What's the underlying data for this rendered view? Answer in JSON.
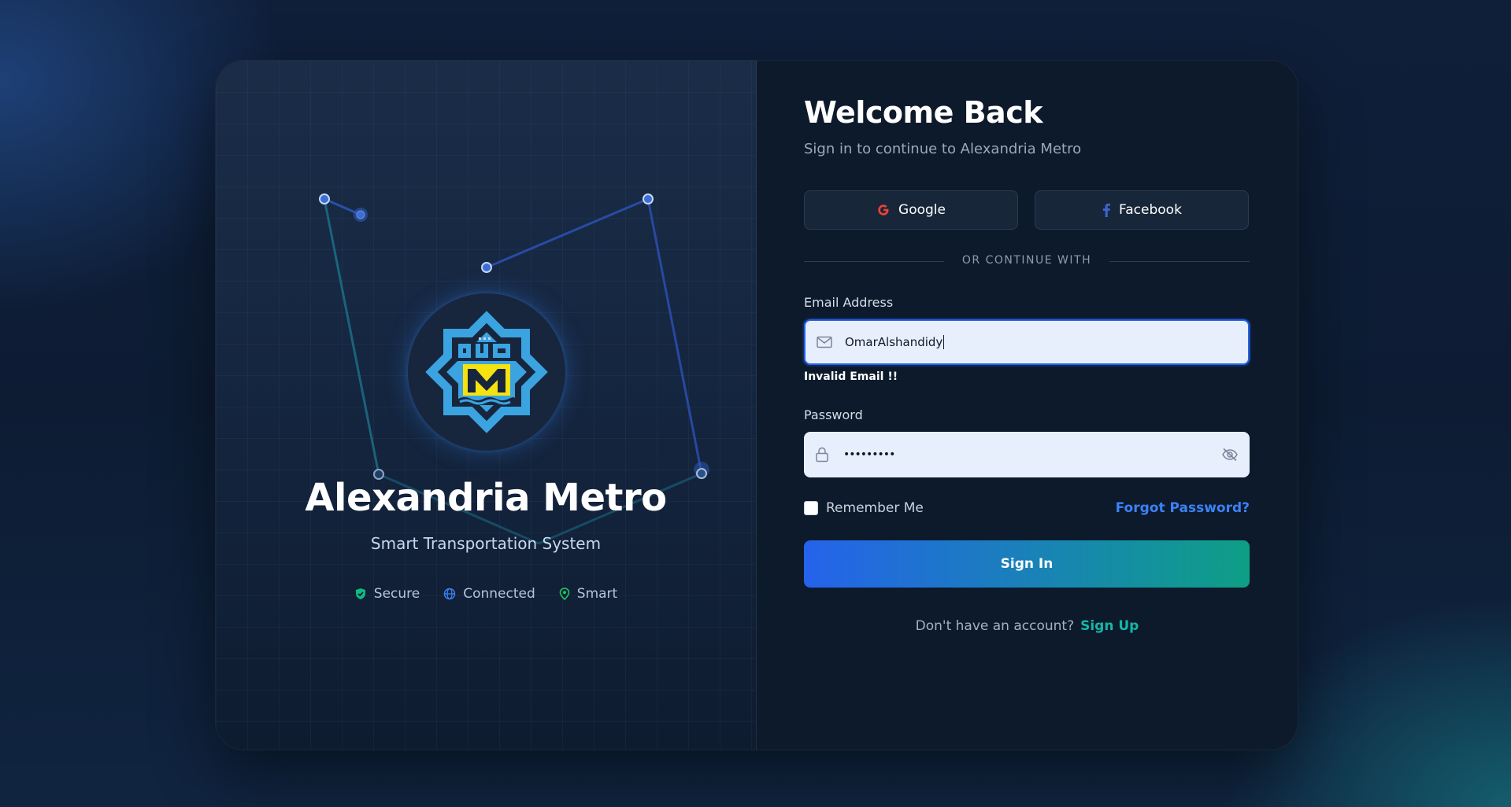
{
  "brand": {
    "title": "Alexandria Metro",
    "subtitle": "Smart Transportation System",
    "logo_text": "مترو",
    "logo_letter": "M",
    "features": [
      {
        "label": "Secure",
        "icon": "shield-check-icon",
        "color": "#10b981"
      },
      {
        "label": "Connected",
        "icon": "globe-icon",
        "color": "#3b82f6"
      },
      {
        "label": "Smart",
        "icon": "map-pin-icon",
        "color": "#22c55e"
      }
    ]
  },
  "login": {
    "title": "Welcome Back",
    "subtitle": "Sign in to continue to Alexandria Metro",
    "social": {
      "google_label": "Google",
      "facebook_label": "Facebook"
    },
    "divider_text": "OR CONTINUE WITH",
    "email": {
      "label": "Email Address",
      "value": "OmarAlshandidy",
      "error": "Invalid Email !!"
    },
    "password": {
      "label": "Password",
      "value": "•••••••••"
    },
    "remember_label": "Remember Me",
    "forgot_label": "Forgot Password?",
    "submit_label": "Sign In",
    "signup_prompt": "Don't have an account?",
    "signup_link": "Sign Up"
  },
  "colors": {
    "accent_blue": "#2563eb",
    "accent_teal": "#0e9f86",
    "link_blue": "#3b82f6",
    "link_teal": "#14b8a6",
    "logo_blue": "#3aa3e0",
    "logo_yellow": "#f5e30f"
  }
}
